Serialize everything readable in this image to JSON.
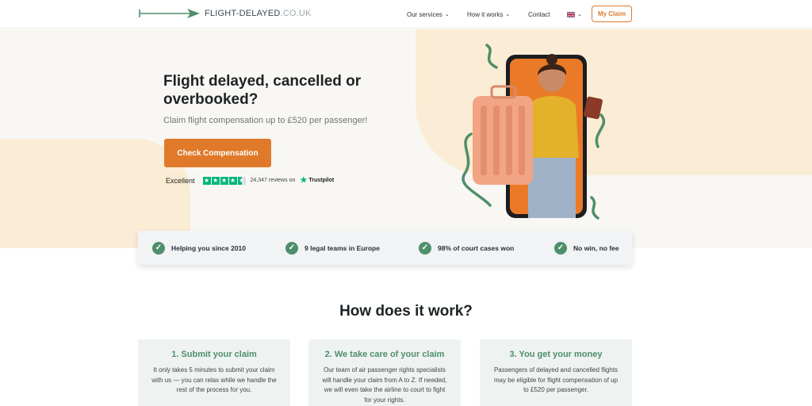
{
  "header": {
    "logo_text": "FLIGHT-DELAYED",
    "logo_domain": ".CO.UK",
    "nav": {
      "our_services": "Our services",
      "how_it_works": "How it works",
      "contact": "Contact"
    },
    "language_icon": "uk-flag-icon",
    "my_claim": "My Claim"
  },
  "hero": {
    "title": "Flight delayed, cancelled or overbooked?",
    "subtitle": "Claim flight compensation up to £520 per passenger!",
    "cta": "Check Compensation",
    "trustpilot": {
      "rating_word": "Excellent",
      "reviews": "24,347 reviews on",
      "brand": "Trustpilot",
      "stars": 4.5
    }
  },
  "features": [
    {
      "label": "Helping you since 2010"
    },
    {
      "label": "9 legal teams in Europe"
    },
    {
      "label": "98% of court cases won"
    },
    {
      "label": "No win, no fee"
    }
  ],
  "how": {
    "title": "How does it work?",
    "steps": [
      {
        "title": "1. Submit your claim",
        "text": "It only takes 5 minutes to submit your claim with us — you can relax while we handle the rest of the process for you."
      },
      {
        "title": "2. We take care of your claim",
        "text": "Our team of air passenger rights specialists will handle your claim from A to Z. If needed, we will even take the airline to court to fight for your rights."
      },
      {
        "title": "3. You get your money",
        "text": "Passengers of delayed and cancelled flights may be eligible for flight compensation of up to £520 per passenger."
      }
    ]
  },
  "colors": {
    "accent": "#e07a2a",
    "green": "#4e8f6a",
    "cream": "#fbecd5"
  }
}
